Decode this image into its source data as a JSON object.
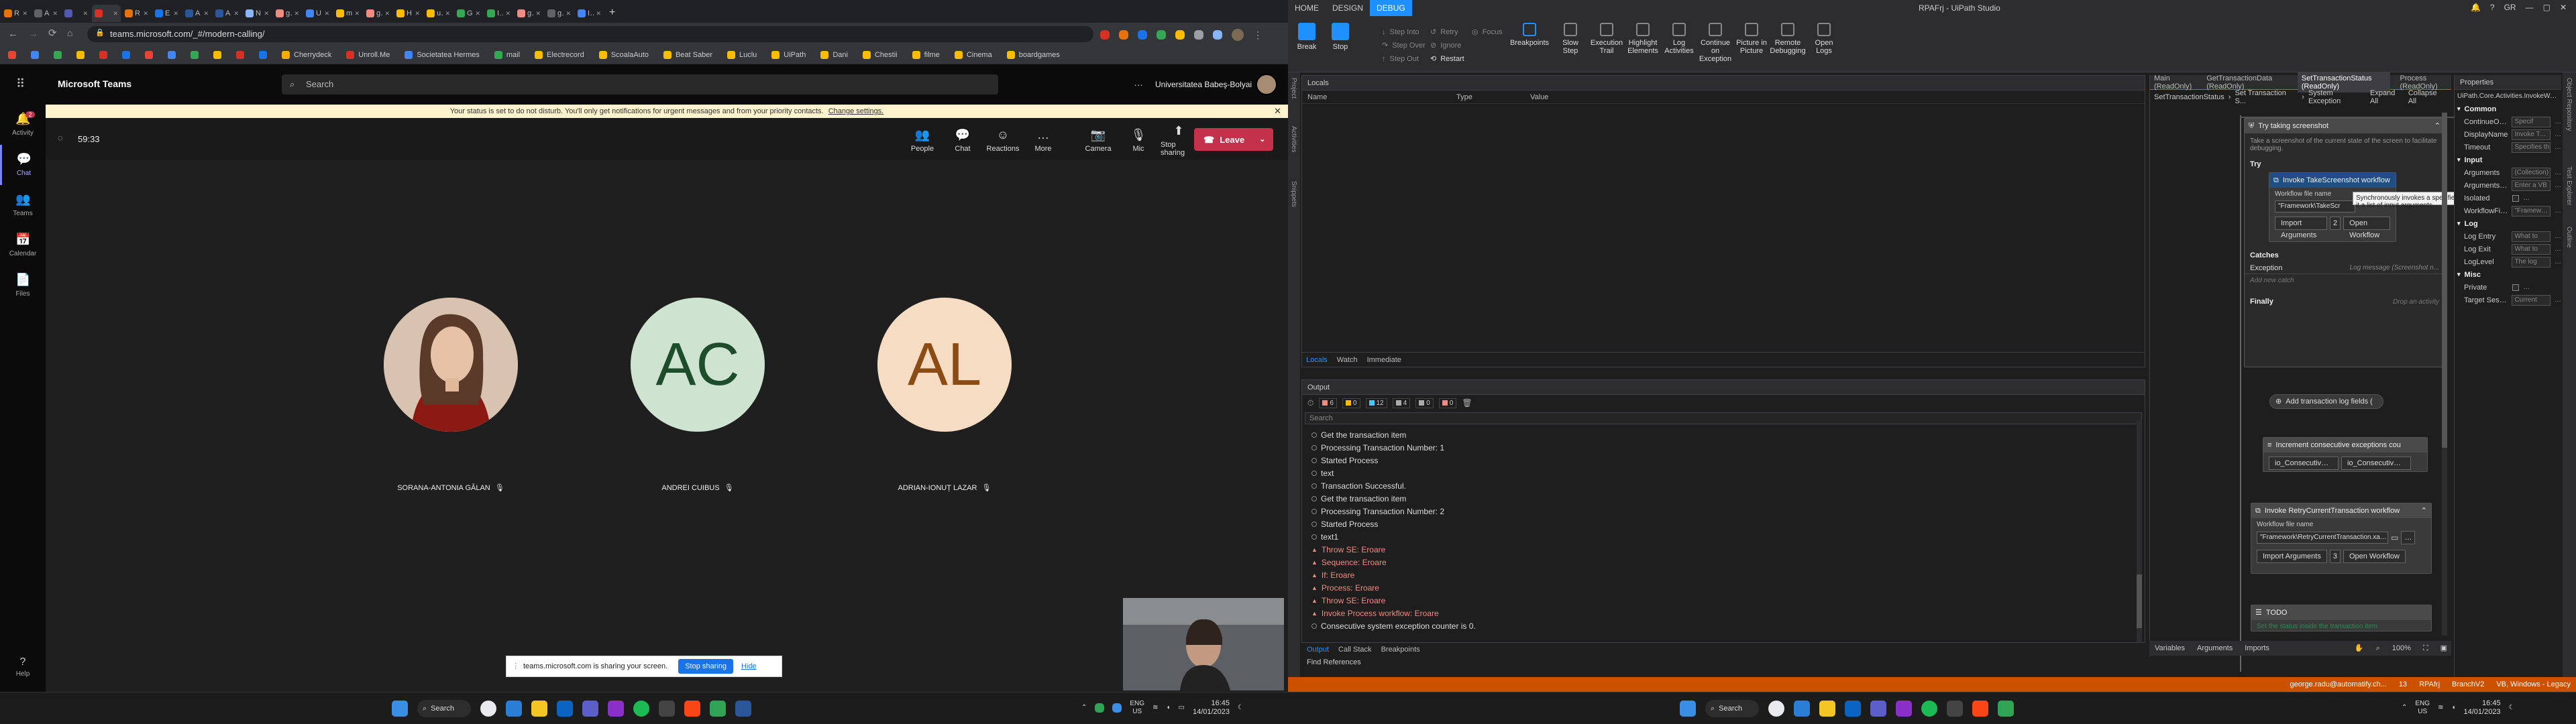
{
  "chrome": {
    "tabs": [
      {
        "label": "RPA",
        "color": "#e8710a"
      },
      {
        "label": "AUT",
        "color": "#5f6368"
      },
      {
        "label": "",
        "color": "#5558af"
      },
      {
        "label": "",
        "color": "#d93025",
        "active": true
      },
      {
        "label": "RPA",
        "color": "#e8710a"
      },
      {
        "label": "Emi",
        "color": "#1a73e8"
      },
      {
        "label": "Aut",
        "color": "#2b579a"
      },
      {
        "label": "Aut",
        "color": "#2b579a"
      },
      {
        "label": "Net",
        "color": "#8ab4f8"
      },
      {
        "label": "gro",
        "color": "#f28b82"
      },
      {
        "label": "Use",
        "color": "#4285f4"
      },
      {
        "label": "me",
        "color": "#fbbc04"
      },
      {
        "label": "gro",
        "color": "#f28b82"
      },
      {
        "label": "Hov",
        "color": "#fbbc04"
      },
      {
        "label": "use",
        "color": "#fbbc04"
      },
      {
        "label": "GAI",
        "color": "#34a853"
      },
      {
        "label": "Insi",
        "color": "#34a853"
      },
      {
        "label": "git",
        "color": "#f28b82"
      },
      {
        "label": "git",
        "color": "#5f6368"
      },
      {
        "label": "Inp",
        "color": "#4285f4"
      }
    ],
    "new_tab": "+",
    "url": "teams.microsoft.com/_#/modern-calling/",
    "bookmarks": [
      "Cherrydeck",
      "Unroll.Me",
      "Societatea Hermes",
      "mail",
      "Electrecord",
      "ScoalaAuto",
      "Beat Saber",
      "Luclu",
      "UiPath",
      "Dani",
      "Chestii",
      "filme",
      "Cinema",
      "boardgames"
    ],
    "bookmark_colors": [
      "#f9ab00",
      "#d93025",
      "#4285f4",
      "#34a853",
      "#fbbc04",
      "#fbbc04",
      "#fbbc04",
      "#fbbc04",
      "#fbbc04",
      "#fbbc04",
      "#fbbc04",
      "#fbbc04",
      "#fbbc04",
      "#fbbc04"
    ]
  },
  "teams": {
    "app_title": "Microsoft Teams",
    "search_placeholder": "Search",
    "org": "Universitatea Babeş-Bolyai",
    "rail": [
      {
        "label": "Activity",
        "icon": "bell-icon",
        "badge": "2"
      },
      {
        "label": "Chat",
        "icon": "chat-icon"
      },
      {
        "label": "Teams",
        "icon": "teams-icon"
      },
      {
        "label": "Calendar",
        "icon": "calendar-icon"
      },
      {
        "label": "Files",
        "icon": "files-icon"
      }
    ],
    "help": "Help",
    "banner_text": "Your status is set to do not disturb. You'll only get notifications for urgent messages and from your priority contacts.",
    "banner_link": "Change settings.",
    "timer": "59:33",
    "meeting_buttons": [
      "People",
      "Chat",
      "Reactions",
      "More",
      "Camera",
      "Mic",
      "Stop sharing"
    ],
    "leave": "Leave",
    "participants": [
      {
        "name": "SORANA-ANTONIA GĂLAN",
        "initials": "",
        "bg": "#c9a58a",
        "fg": "#000"
      },
      {
        "name": "ANDREI CUIBUS",
        "initials": "AC",
        "bg": "#cfe3d1",
        "fg": "#1e4d2b"
      },
      {
        "name": "ADRIAN-IONUȚ LAZAR",
        "initials": "AL",
        "bg": "#f7dcc4",
        "fg": "#8a4b14"
      }
    ],
    "share_text": "teams.microsoft.com is sharing your screen.",
    "stop_sharing": "Stop sharing",
    "hide": "Hide"
  },
  "taskbar_left": {
    "search": "Search",
    "lang": "ENG",
    "region": "US",
    "time": "16:45",
    "date": "14/01/2023"
  },
  "taskbar_right": {
    "search": "Search",
    "lang": "ENG",
    "region": "US",
    "time": "16:45",
    "date": "14/01/2023"
  },
  "studio": {
    "title": "RPAFrj - UiPath Studio",
    "ribbon_tabs": [
      "HOME",
      "DESIGN",
      "DEBUG"
    ],
    "ribbon_big": [
      "Break",
      "Stop"
    ],
    "ribbon_small": [
      "Step Into",
      "Step Over",
      "Step Out",
      "Retry",
      "Ignore",
      "Restart",
      "Focus"
    ],
    "ribbon_more": [
      "Breakpoints",
      "Slow Step",
      "Execution Trail",
      "Highlight Elements",
      "Log Activities",
      "Continue on Exception",
      "Picture in Picture",
      "Remote Debugging",
      "Open Logs"
    ],
    "user": "GR",
    "locals_title": "Locals",
    "locals_cols": [
      "Name",
      "Type",
      "Value"
    ],
    "locals_tabs": [
      "Locals",
      "Watch",
      "Immediate"
    ],
    "output_title": "Output",
    "output_counts": [
      "6",
      "0",
      "12",
      "4",
      "0",
      "0"
    ],
    "output_search": "Search",
    "output_lines": [
      {
        "t": "Get the transaction item",
        "e": false
      },
      {
        "t": "Processing Transaction Number: 1",
        "e": false
      },
      {
        "t": "Started Process",
        "e": false
      },
      {
        "t": "text",
        "e": false
      },
      {
        "t": "Transaction Successful.",
        "e": false
      },
      {
        "t": "Get the transaction item",
        "e": false
      },
      {
        "t": "Processing Transaction Number: 2",
        "e": false
      },
      {
        "t": "Started Process",
        "e": false
      },
      {
        "t": "text1",
        "e": false
      },
      {
        "t": "Throw SE: Eroare",
        "e": true
      },
      {
        "t": "Sequence: Eroare",
        "e": true
      },
      {
        "t": "If: Eroare",
        "e": true
      },
      {
        "t": "Process: Eroare",
        "e": true
      },
      {
        "t": "Throw SE: Eroare",
        "e": true
      },
      {
        "t": "Invoke Process workflow: Eroare",
        "e": true
      },
      {
        "t": "Consecutive system exception counter is 0.",
        "e": false
      }
    ],
    "output_tabs": [
      "Output",
      "Call Stack",
      "Breakpoints"
    ],
    "find_refs": "Find References",
    "doc_tabs": [
      "Main (ReadOnly)",
      "GetTransactionData (ReadOnly)",
      "SetTransactionStatus (ReadOnly)",
      "Process (ReadOnly)"
    ],
    "breadcrumb": [
      "SetTransactionStatus",
      "Set Transaction S...",
      "System Exception"
    ],
    "expand_all": "Expand All",
    "collapse_all": "Collapse All",
    "try_catch_title": "Try taking screenshot",
    "try_catch_desc": "Take a screenshot of the current state of the screen to facilitate debugging.",
    "try_label": "Try",
    "invoke1_title": "Invoke TakeScreenshot workflow",
    "wf_file_label": "Workflow file name",
    "invoke1_file": "\"Framework\\TakeScr",
    "import_args": "Import Arguments",
    "import_count1": "2",
    "open_wf": "Open Workflow",
    "tooltip": "Synchronously invokes a specified workflow, optionally passing it a list of input arguments.",
    "catches": "Catches",
    "exception": "Exception",
    "log_msg": "Log message (Screenshot n...",
    "add_catch": "Add new catch",
    "finally": "Finally",
    "add_activity": "Drop an activity",
    "add_log": "Add transaction log fields (",
    "incr_title": "Increment consecutive exceptions cou",
    "incr_a": "io_ConsecutiveSys",
    "incr_b": "io_ConsecutiveSys",
    "invoke2_title": "Invoke RetryCurrentTransaction workflow",
    "invoke2_file": "\"Framework\\RetryCurrentTransaction.xaml\"",
    "import_count2": "3",
    "todo": "TODO",
    "todo_text": "Set the status inside the transaction item",
    "bottom_tabs": [
      "Variables",
      "Arguments",
      "Imports"
    ],
    "zoom": "100%",
    "left_vtabs": [
      "Project",
      "Activities",
      "Snippets"
    ],
    "right_vtabs": [
      "Object Repository",
      "Test Explorer",
      "Outline"
    ],
    "props_title": "Properties",
    "props_class": "UiPath.Core.Activities.InvokeWorkflowFile",
    "props": [
      {
        "g": "Common"
      },
      {
        "k": "ContinueOnError",
        "v": "Specif"
      },
      {
        "k": "DisplayName",
        "v": "Invoke TakeScre"
      },
      {
        "k": "Timeout",
        "v": "Specifies th"
      },
      {
        "g": "Input"
      },
      {
        "k": "Arguments",
        "v": "(Collection)"
      },
      {
        "k": "ArgumentsVariable",
        "v": "Enter a VB"
      },
      {
        "k": "Isolated",
        "v": ""
      },
      {
        "k": "WorkflowFileName",
        "v": "\"Framework"
      },
      {
        "g": "Log"
      },
      {
        "k": "Log Entry",
        "v": "What to"
      },
      {
        "k": "Log Exit",
        "v": "What to"
      },
      {
        "k": "LogLevel",
        "v": "The log"
      },
      {
        "g": "Misc"
      },
      {
        "k": "Private",
        "v": ""
      },
      {
        "k": "Target Session",
        "v": "Current"
      }
    ],
    "status_left": "",
    "status_user": "george.radu@automatify.ch...",
    "status_changes": "13",
    "status_project": "RPAfrj",
    "status_branch": "BranchV2",
    "status_target": "VB, Windows - Legacy"
  },
  "colors": {
    "teams_accent": "#6264a7",
    "leave": "#c4314b",
    "studio_accent": "#1e90ff",
    "status_orange": "#ca5100",
    "error": "#f28b82"
  }
}
